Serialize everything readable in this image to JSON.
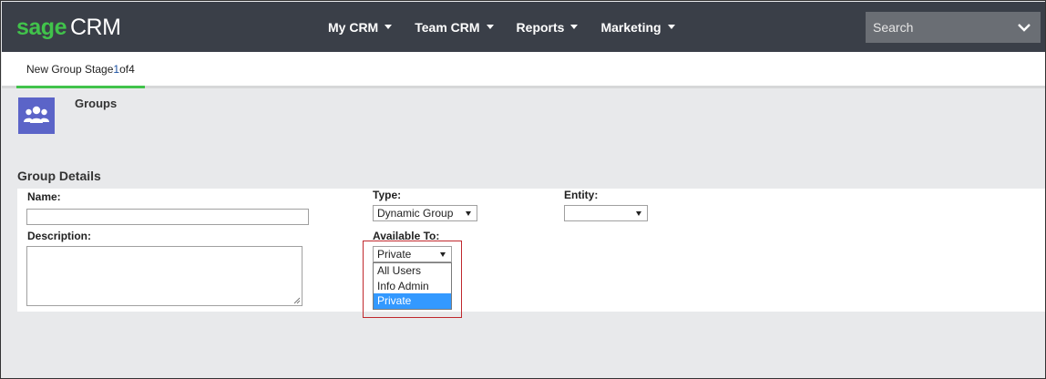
{
  "brand": {
    "sage": "sage",
    "crm": "CRM",
    "color": "#41c34b"
  },
  "nav": [
    {
      "label": "My CRM"
    },
    {
      "label": "Team CRM"
    },
    {
      "label": "Reports"
    },
    {
      "label": "Marketing"
    }
  ],
  "search": {
    "placeholder": "Search",
    "icon": "chevron-down-icon"
  },
  "stage": {
    "prefix": "New Group Stage ",
    "current": "1",
    "middle": " of ",
    "total": "4"
  },
  "header": {
    "title": "Groups",
    "icon": "users-icon"
  },
  "section": {
    "title": "Group Details"
  },
  "form": {
    "name_label": "Name:",
    "name_value": "",
    "description_label": "Description:",
    "description_value": "",
    "type_label": "Type:",
    "type_value": "Dynamic Group",
    "entity_label": "Entity:",
    "entity_value": "",
    "available_label": "Available To:",
    "available_value": "Private",
    "available_options": [
      "All Users",
      "Info Admin",
      "Private"
    ]
  },
  "colors": {
    "topbar": "#3a3f48",
    "accent": "#41c34b",
    "highlight": "#c0282d",
    "selection": "#3399ff"
  }
}
